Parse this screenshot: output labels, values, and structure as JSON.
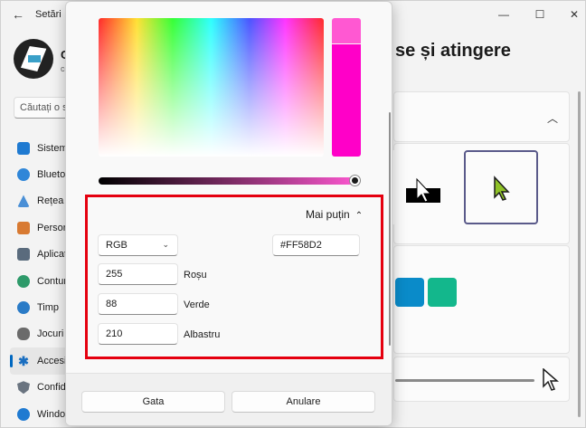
{
  "window": {
    "app_title": "Setări",
    "back_icon": "←",
    "minimize_icon": "—",
    "maximize_icon": "☐",
    "close_icon": "✕"
  },
  "profile": {
    "name": "C",
    "subtitle": "co"
  },
  "search": {
    "placeholder": "Căutați o se"
  },
  "nav": {
    "items": [
      {
        "label": "Sistem",
        "color": "#1f7ad1"
      },
      {
        "label": "Bluetooth",
        "color": "#2f86d8"
      },
      {
        "label": "Rețea",
        "color": "#4a8fd6"
      },
      {
        "label": "Personalizare",
        "color": "#d87a32"
      },
      {
        "label": "Aplicații",
        "color": "#5a6b7d"
      },
      {
        "label": "Conturi",
        "color": "#2e9a6a"
      },
      {
        "label": "Timp",
        "color": "#2a7bc7"
      },
      {
        "label": "Jocuri",
        "color": "#6b6b6b"
      },
      {
        "label": "Accesibilitate",
        "color": "#1a6ec0",
        "active": true
      },
      {
        "label": "Confidențialitate",
        "color": "#6a7480"
      },
      {
        "label": "Windows Update",
        "color": "#1f7ad1"
      }
    ]
  },
  "page": {
    "heading": "se și atingere"
  },
  "colors": {
    "selected_hex": "#FF58D2",
    "swatch_blue": "#0a8bc9",
    "swatch_teal": "#13b78c",
    "accent": "#0067c0",
    "highlight_border": "#e5000f"
  },
  "dialog": {
    "less_label": "Mai puțin",
    "less_chevron": "⌃",
    "mode_value": "RGB",
    "mode_chevron": "⌄",
    "hex_value": "#FF58D2",
    "red": {
      "value": "255",
      "label": "Roșu"
    },
    "green": {
      "value": "88",
      "label": "Verde"
    },
    "blue": {
      "value": "210",
      "label": "Albastru"
    },
    "done_label": "Gata",
    "cancel_label": "Anulare"
  }
}
